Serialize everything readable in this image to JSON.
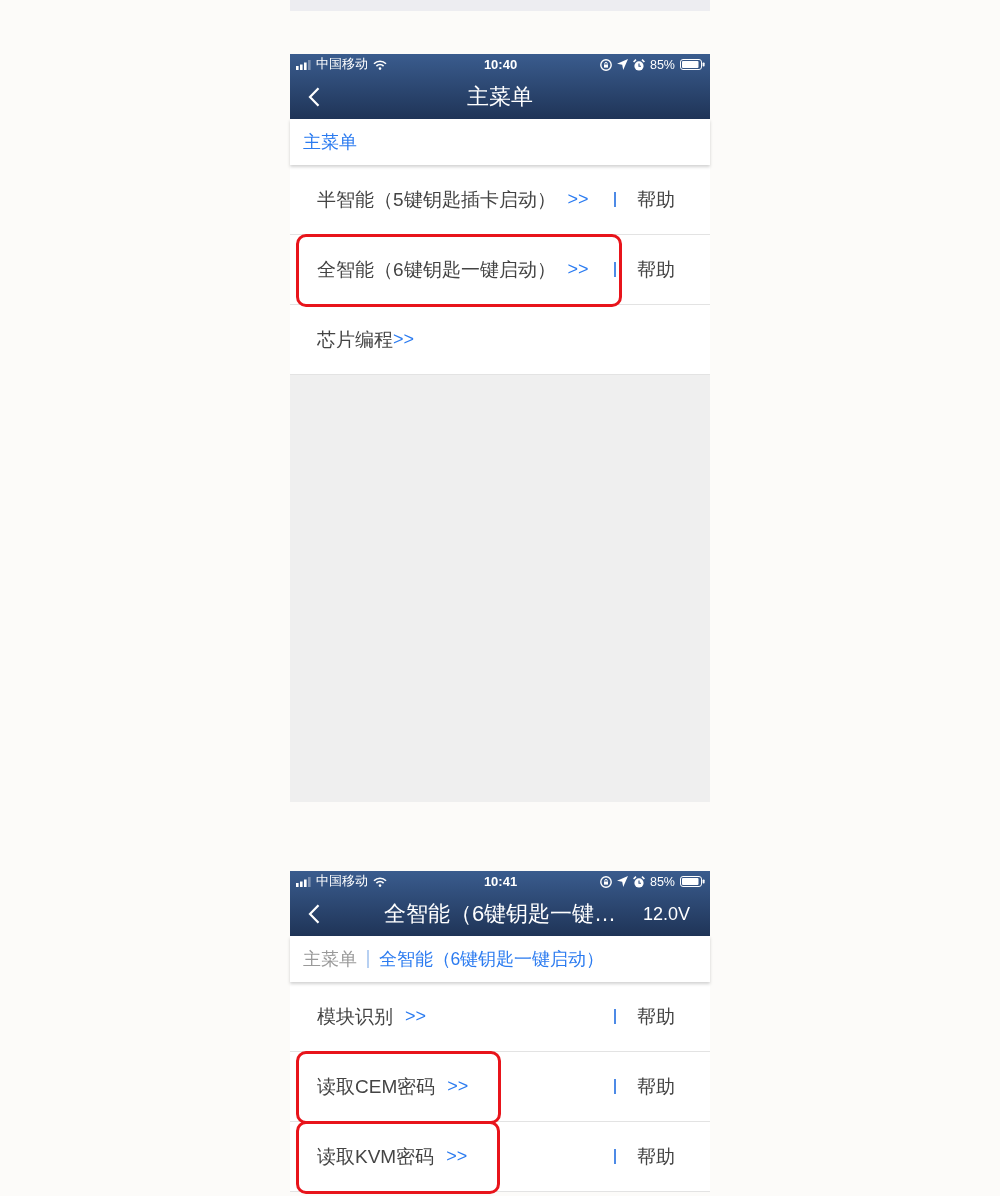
{
  "screens": [
    {
      "status_bar": {
        "carrier": "中国移动",
        "time": "10:40",
        "battery": "85%"
      },
      "nav_bar": {
        "title": "主菜单"
      },
      "breadcrumb": [
        {
          "label": "主菜单",
          "selected": true
        }
      ],
      "rows": [
        {
          "label": "半智能（5键钥匙插卡启动）",
          "arrow": ">>",
          "help": "帮助",
          "highlighted": false
        },
        {
          "label": "全智能（6键钥匙一键启动）",
          "arrow": ">>",
          "help": "帮助",
          "highlighted": true
        },
        {
          "label": "芯片编程",
          "arrow": ">>",
          "highlighted": false
        }
      ],
      "empty_area": true
    },
    {
      "status_bar": {
        "carrier": "中国移动",
        "time": "10:41",
        "battery": "85%"
      },
      "nav_bar": {
        "title": "全智能（6键钥匙一键…",
        "voltage": "12.0V"
      },
      "breadcrumb": [
        {
          "label": "主菜单",
          "selected": false
        },
        {
          "label": "全智能（6键钥匙一键启动）",
          "selected": true
        }
      ],
      "rows": [
        {
          "label": "模块识别",
          "arrow": ">>",
          "help": "帮助",
          "highlighted": false
        },
        {
          "label": "读取CEM密码",
          "arrow": ">>",
          "help": "帮助",
          "highlighted": true
        },
        {
          "label": "读取KVM密码",
          "arrow": ">>",
          "help": "帮助",
          "highlighted": true
        }
      ]
    }
  ]
}
